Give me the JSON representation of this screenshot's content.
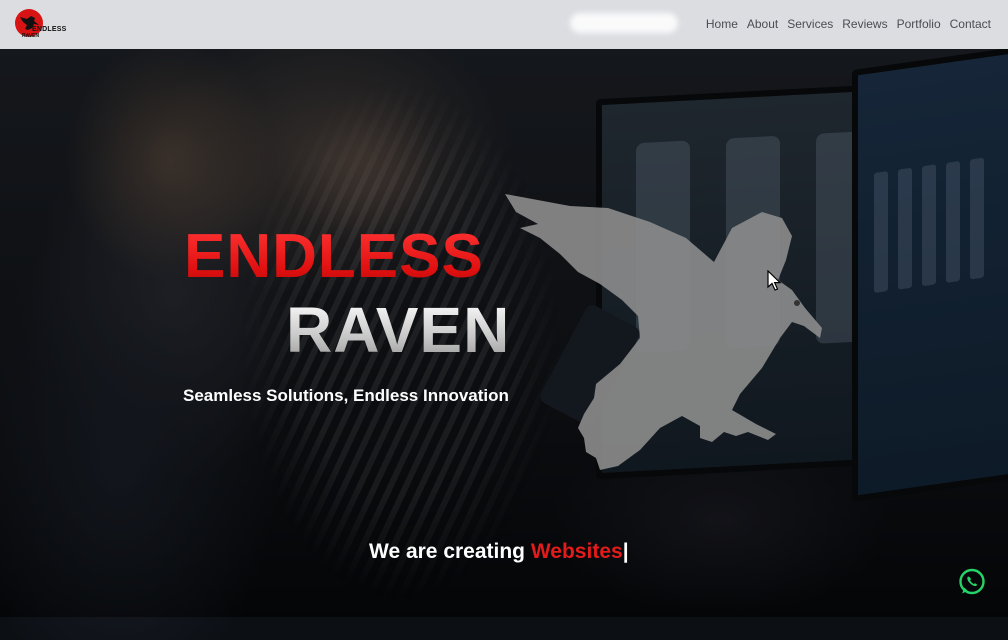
{
  "brand": {
    "logo_line1": "ENDLESS",
    "logo_line2": "RAVEN"
  },
  "nav": {
    "items": [
      {
        "label": "Home"
      },
      {
        "label": "About"
      },
      {
        "label": "Services"
      },
      {
        "label": "Reviews"
      },
      {
        "label": "Portfolio"
      },
      {
        "label": "Contact"
      }
    ]
  },
  "hero": {
    "title_line1": "ENDLESS",
    "title_line2": "RAVEN",
    "tagline": "Seamless Solutions, Endless Innovation",
    "creating_prefix": "We are creating ",
    "creating_word": "Websites",
    "caret": "|"
  },
  "colors": {
    "accent_red": "#e31b1b",
    "nav_bg": "#e8eaee",
    "nav_text": "#4a4d55",
    "whatsapp_green": "#25d366"
  },
  "icons": [
    "raven-logo-icon",
    "raven-illustration-icon",
    "whatsapp-icon",
    "mouse-cursor-icon"
  ]
}
